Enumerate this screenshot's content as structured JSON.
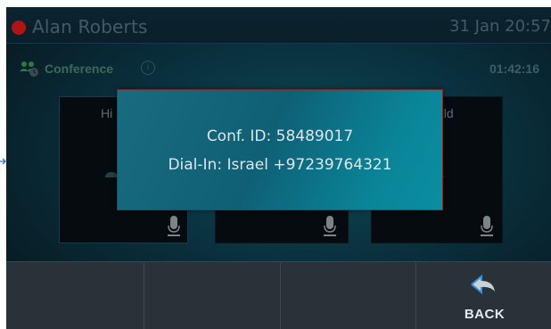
{
  "topbar": {
    "caller_name": "Alan Roberts",
    "datetime": "31 Jan 20:57",
    "status_color": "#b01515"
  },
  "conference": {
    "title": "Conference",
    "info_icon": "info-icon",
    "duration": "01:42:16"
  },
  "participants": [
    {
      "name": "Hi",
      "muted": true
    },
    {
      "name": "",
      "muted": true
    },
    {
      "name": "ald",
      "muted": true
    }
  ],
  "popup": {
    "conf_id": "Conf. ID: 58489017",
    "dial_in": "Dial-In: Israel +97239764321"
  },
  "softkeys": [
    {
      "label": ""
    },
    {
      "label": ""
    },
    {
      "label": ""
    },
    {
      "label": "BACK",
      "icon": "back-arrow-icon"
    }
  ]
}
